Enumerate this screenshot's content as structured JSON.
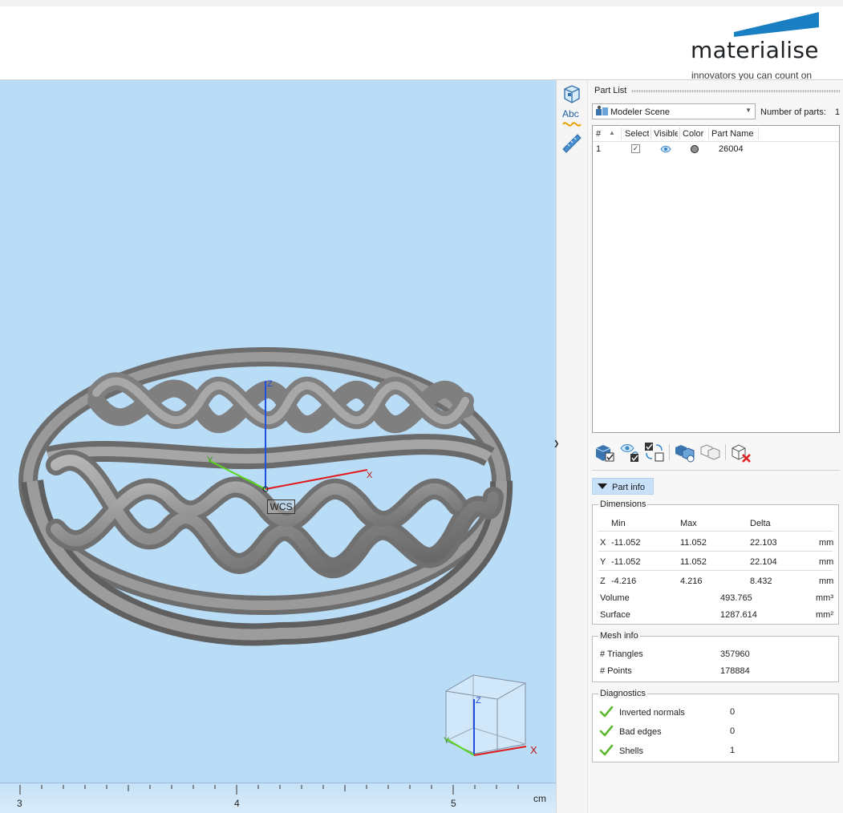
{
  "header": {
    "logo_text": "materialise",
    "logo_tagline": "innovators you can count on",
    "logo_color": "#1a7fc2"
  },
  "viewport": {
    "background": "#b9dcf7",
    "wcs_label": "WCS",
    "axis_x_label": "X",
    "axis_y_label": "Y",
    "axis_z_label": "Z",
    "cube_x_label": "X",
    "cube_y_label": "Y",
    "cube_z_label": "Z",
    "ruler": {
      "ticks": [
        "3",
        "4",
        "5"
      ],
      "unit": "cm"
    }
  },
  "toolstrip": {
    "icons": [
      "view-cube-icon",
      "text-annotation-icon",
      "ruler-measure-icon"
    ],
    "abc_text": "Abc"
  },
  "part_list": {
    "title": "Part List",
    "scene_select_value": "Modeler Scene",
    "number_of_parts_label": "Number of parts:",
    "number_of_parts_value": "1",
    "columns": [
      "#",
      "Select",
      "Visible",
      "Color",
      "Part Name"
    ],
    "rows": [
      {
        "index": "1",
        "selected": true,
        "visible": true,
        "color": "#8f8f8f",
        "name": "26004"
      }
    ]
  },
  "actions": {
    "icons": [
      "select-all-parts-icon",
      "toggle-visibility-icon",
      "invert-selection-icon",
      "group-parts-icon",
      "ungroup-parts-icon",
      "delete-part-icon"
    ]
  },
  "part_info": {
    "tab_label": "Part info",
    "dimensions": {
      "title": "Dimensions",
      "header": [
        "Min",
        "Max",
        "Delta"
      ],
      "rows": [
        {
          "axis": "X",
          "min": "-11.052",
          "max": "11.052",
          "delta": "22.103",
          "unit": "mm"
        },
        {
          "axis": "Y",
          "min": "-11.052",
          "max": "11.052",
          "delta": "22.104",
          "unit": "mm"
        },
        {
          "axis": "Z",
          "min": "-4.216",
          "max": "4.216",
          "delta": "8.432",
          "unit": "mm"
        }
      ],
      "volume_label": "Volume",
      "volume_value": "493.765",
      "volume_unit": "mm³",
      "surface_label": "Surface",
      "surface_value": "1287.614",
      "surface_unit": "mm²"
    },
    "mesh_info": {
      "title": "Mesh info",
      "triangles_label": "# Triangles",
      "triangles_value": "357960",
      "points_label": "# Points",
      "points_value": "178884"
    },
    "diagnostics": {
      "title": "Diagnostics",
      "items": [
        {
          "label": "Inverted normals",
          "value": "0"
        },
        {
          "label": "Bad edges",
          "value": "0"
        },
        {
          "label": "Shells",
          "value": "1"
        }
      ],
      "ok_color": "#5cb82e"
    }
  }
}
